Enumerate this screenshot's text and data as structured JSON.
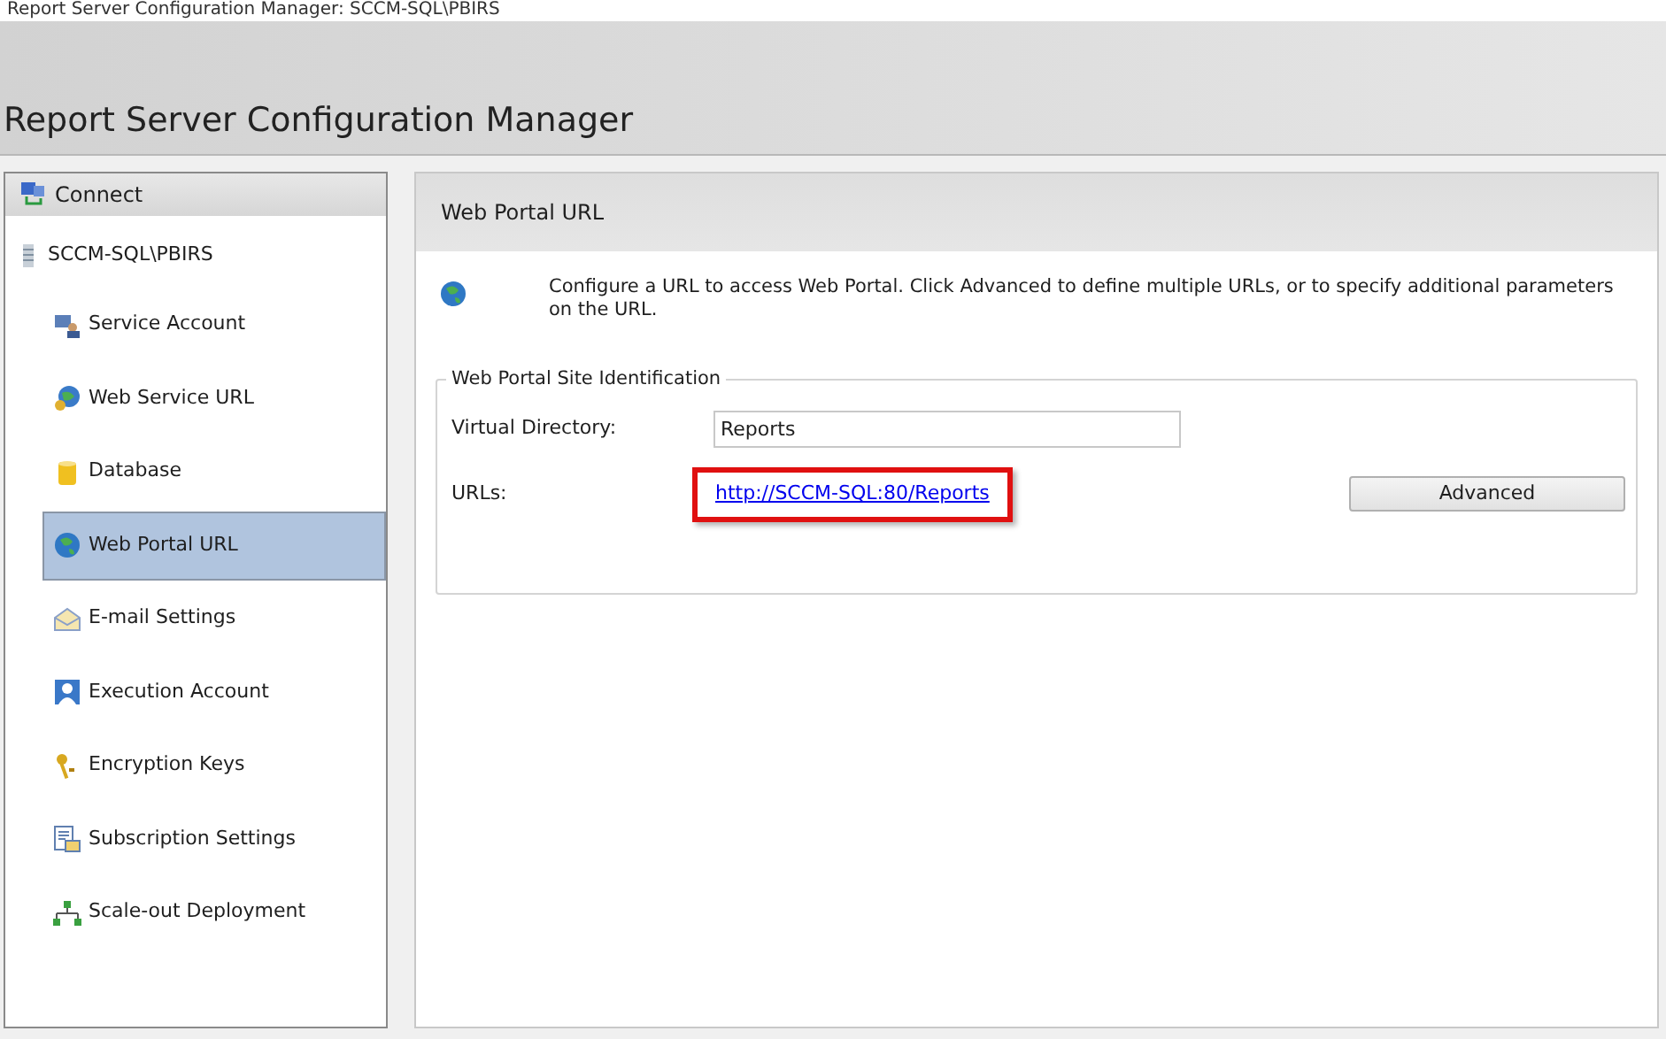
{
  "window": {
    "title": "Report Server Configuration Manager: SCCM-SQL\\PBIRS"
  },
  "header": {
    "title": "Report Server Configuration Manager"
  },
  "sidebar": {
    "connect": "Connect",
    "server": "SCCM-SQL\\PBIRS",
    "items": [
      {
        "label": "Service Account",
        "kind": "service",
        "selected": false
      },
      {
        "label": "Web Service URL",
        "kind": "webservice",
        "selected": false
      },
      {
        "label": "Database",
        "kind": "database",
        "selected": false
      },
      {
        "label": "Web Portal URL",
        "kind": "globe",
        "selected": true
      },
      {
        "label": "E-mail Settings",
        "kind": "email",
        "selected": false
      },
      {
        "label": "Execution Account",
        "kind": "user",
        "selected": false
      },
      {
        "label": "Encryption Keys",
        "kind": "keys",
        "selected": false
      },
      {
        "label": "Subscription Settings",
        "kind": "subscription",
        "selected": false
      },
      {
        "label": "Scale-out Deployment",
        "kind": "scaleout",
        "selected": false
      }
    ]
  },
  "panel": {
    "title": "Web Portal URL",
    "description": "Configure a URL to access Web Portal.  Click Advanced to define multiple URLs, or to specify additional parameters on the URL.",
    "group": {
      "legend": "Web Portal Site Identification",
      "virtual_directory_label": "Virtual Directory:",
      "virtual_directory_value": "Reports",
      "urls_label": "URLs:",
      "url": "http://SCCM-SQL:80/Reports",
      "url_highlighted": true,
      "advanced_button": "Advanced"
    }
  }
}
